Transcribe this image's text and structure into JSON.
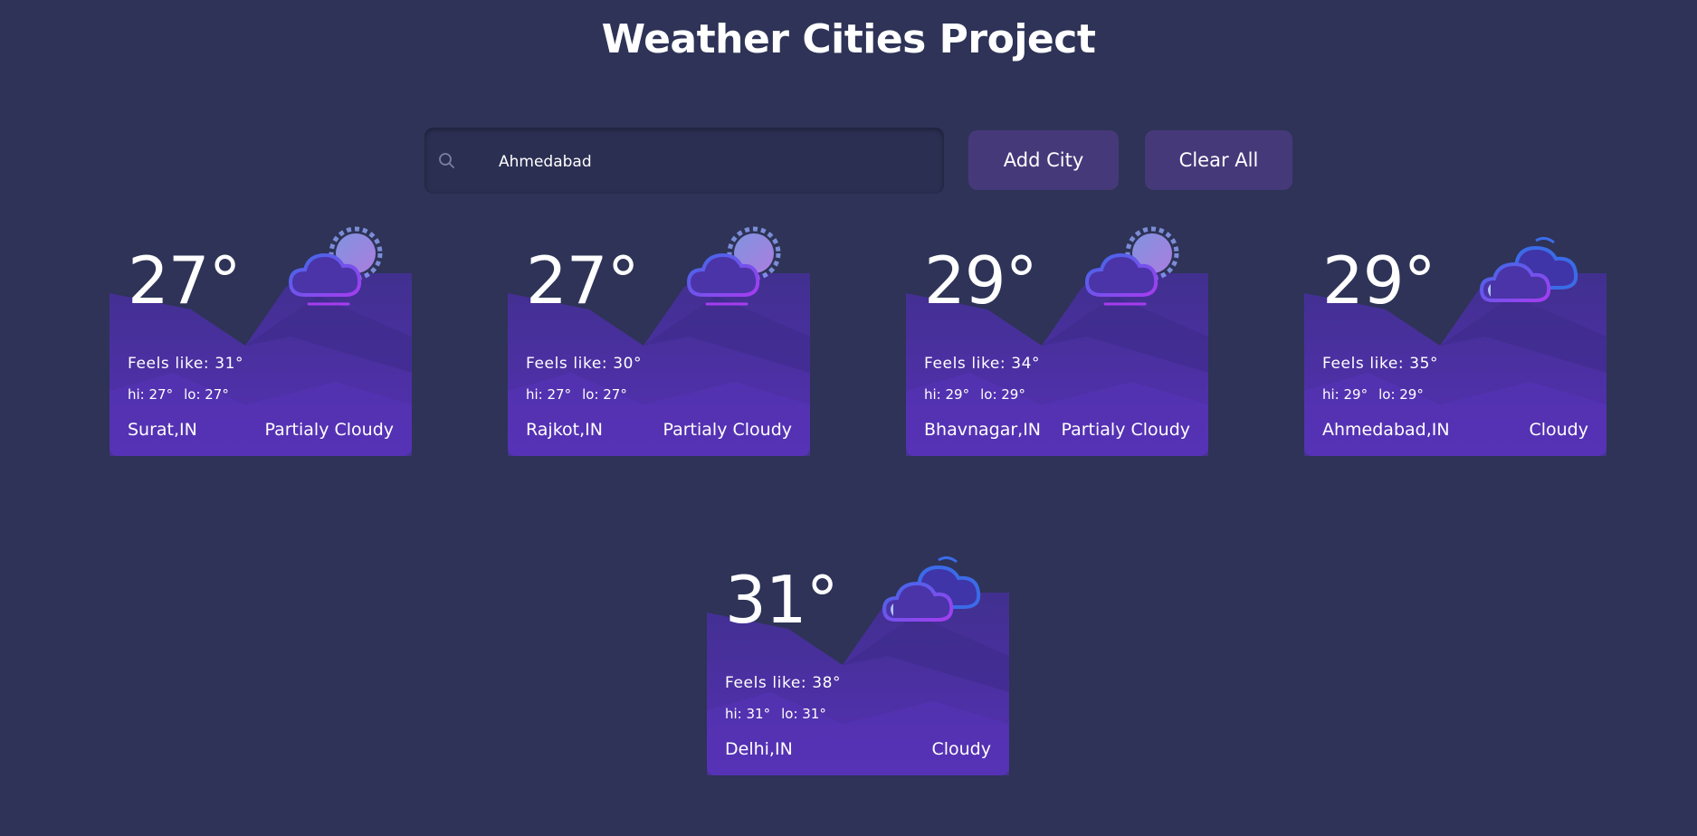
{
  "header": {
    "title": "Weather Cities Project"
  },
  "search": {
    "value": "Ahmedabad"
  },
  "toolbar": {
    "add_label": "Add City",
    "clear_label": "Clear All"
  },
  "cards": [
    {
      "temp": "27°",
      "feels": "Feels like: 31°",
      "hi": "hi: 27°",
      "lo": "lo: 27°",
      "city": "Surat,IN",
      "condition": "Partialy Cloudy",
      "icon": "partly-cloudy-day-icon"
    },
    {
      "temp": "27°",
      "feels": "Feels like: 30°",
      "hi": "hi: 27°",
      "lo": "lo: 27°",
      "city": "Rajkot,IN",
      "condition": "Partialy Cloudy",
      "icon": "partly-cloudy-day-icon"
    },
    {
      "temp": "29°",
      "feels": "Feels like: 34°",
      "hi": "hi: 29°",
      "lo": "lo: 29°",
      "city": "Bhavnagar,IN",
      "condition": "Partialy Cloudy",
      "icon": "partly-cloudy-day-icon"
    },
    {
      "temp": "29°",
      "feels": "Feels like: 35°",
      "hi": "hi: 29°",
      "lo": "lo: 29°",
      "city": "Ahmedabad,IN",
      "condition": "Cloudy",
      "icon": "cloudy-icon"
    },
    {
      "temp": "31°",
      "feels": "Feels like: 38°",
      "hi": "hi: 31°",
      "lo": "lo: 31°",
      "city": "Delhi,IN",
      "condition": "Cloudy",
      "icon": "cloudy-icon"
    }
  ],
  "colors": {
    "background": "#2e3357",
    "button": "#46397a",
    "card": "#4f30a8",
    "icon_stroke": "#8a3cf0"
  }
}
